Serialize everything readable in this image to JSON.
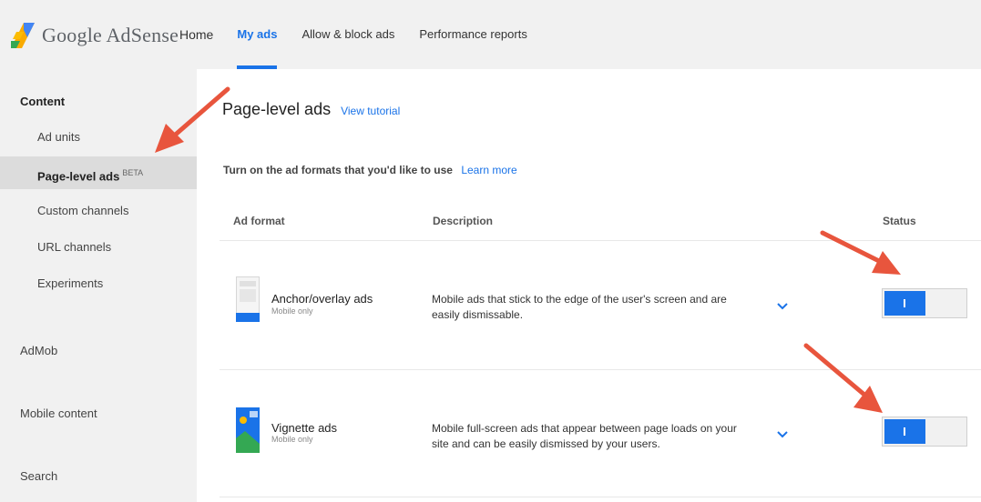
{
  "app": {
    "logo_text": "Google AdSense"
  },
  "nav": {
    "items": [
      {
        "label": "Home"
      },
      {
        "label": "My ads"
      },
      {
        "label": "Allow & block ads"
      },
      {
        "label": "Performance reports"
      }
    ]
  },
  "sidebar": {
    "heading": "Content",
    "items": [
      {
        "label": "Ad units"
      },
      {
        "label": "Page-level ads",
        "badge": "BETA"
      },
      {
        "label": "Custom channels"
      },
      {
        "label": "URL channels"
      },
      {
        "label": "Experiments"
      }
    ],
    "sections": [
      {
        "label": "AdMob"
      },
      {
        "label": "Mobile content"
      },
      {
        "label": "Search"
      }
    ]
  },
  "main": {
    "title": "Page-level ads",
    "title_link": "View tutorial",
    "intro": "Turn on the ad formats that you'd like to use",
    "intro_link": "Learn more",
    "columns": [
      "Ad format",
      "Description",
      "Status"
    ],
    "rows": [
      {
        "name": "Anchor/overlay ads",
        "sub": "Mobile only",
        "desc_line1": "Mobile ads that stick to the edge of the user's screen and are",
        "desc_line2": "easily dismissable.",
        "status_on": true
      },
      {
        "name": "Vignette ads",
        "sub": "Mobile only",
        "desc_line1": "Mobile full-screen ads that appear between page loads on your",
        "desc_line2": "site and can be easily dismissed by your users.",
        "status_on": true
      }
    ]
  },
  "colors": {
    "accent": "#1a73e8",
    "arrow": "#e8553d",
    "topbar_bg": "#f1f1f1",
    "active_item_bg": "#dcdcdc"
  },
  "icons": [
    "adsense-logo-icon",
    "chevron-down-icon",
    "anchor-ad-icon",
    "vignette-ad-icon",
    "red-arrow-annotation"
  ]
}
